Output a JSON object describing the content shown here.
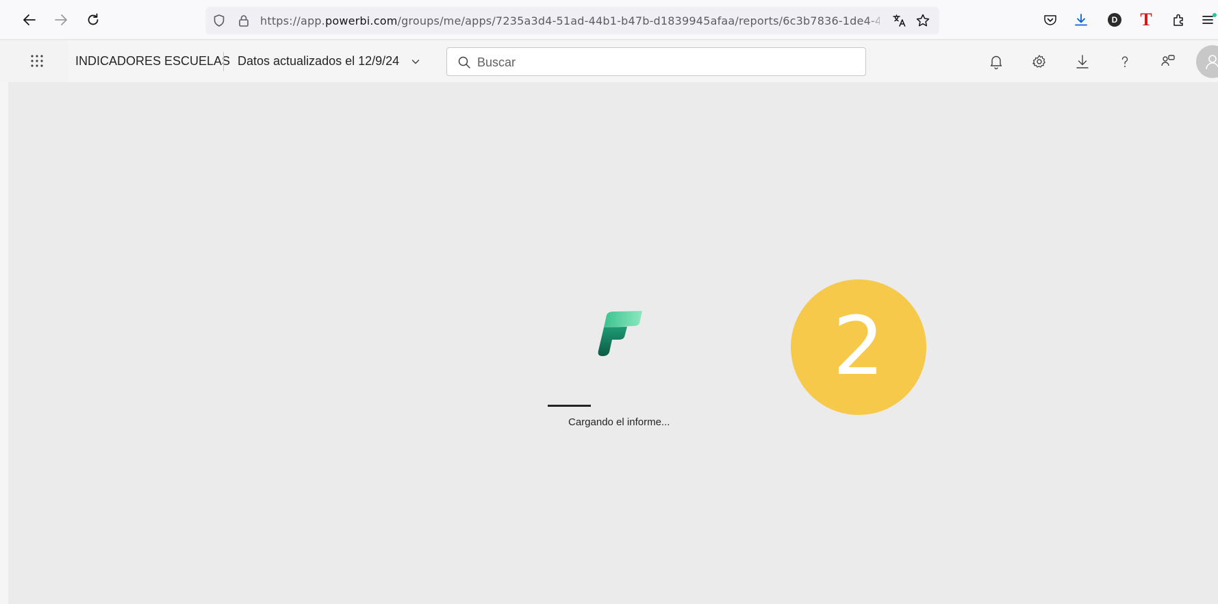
{
  "browser": {
    "url_prefix": "https://app.",
    "url_host": "powerbi.com",
    "url_path": "/groups/me/apps/7235a3d4-51ad-44b1-b47b-d1839945afaa/reports/6c3b7836-1de4-4",
    "extension_letter": "D",
    "extension_t": "T"
  },
  "header": {
    "app_title": "INDICADORES ESCUELAS",
    "date_label": "Datos actualizados el 12/9/24",
    "search_placeholder": "Buscar"
  },
  "content": {
    "loading_text": "Cargando el informe...",
    "loading_progress_fraction": 0.35,
    "step_number": "2"
  },
  "colors": {
    "accent_badge": "#f6c94b",
    "logo_green_light": "#7be0b4",
    "logo_green_dark": "#0f6b4f",
    "download_blue": "#0061e0"
  }
}
